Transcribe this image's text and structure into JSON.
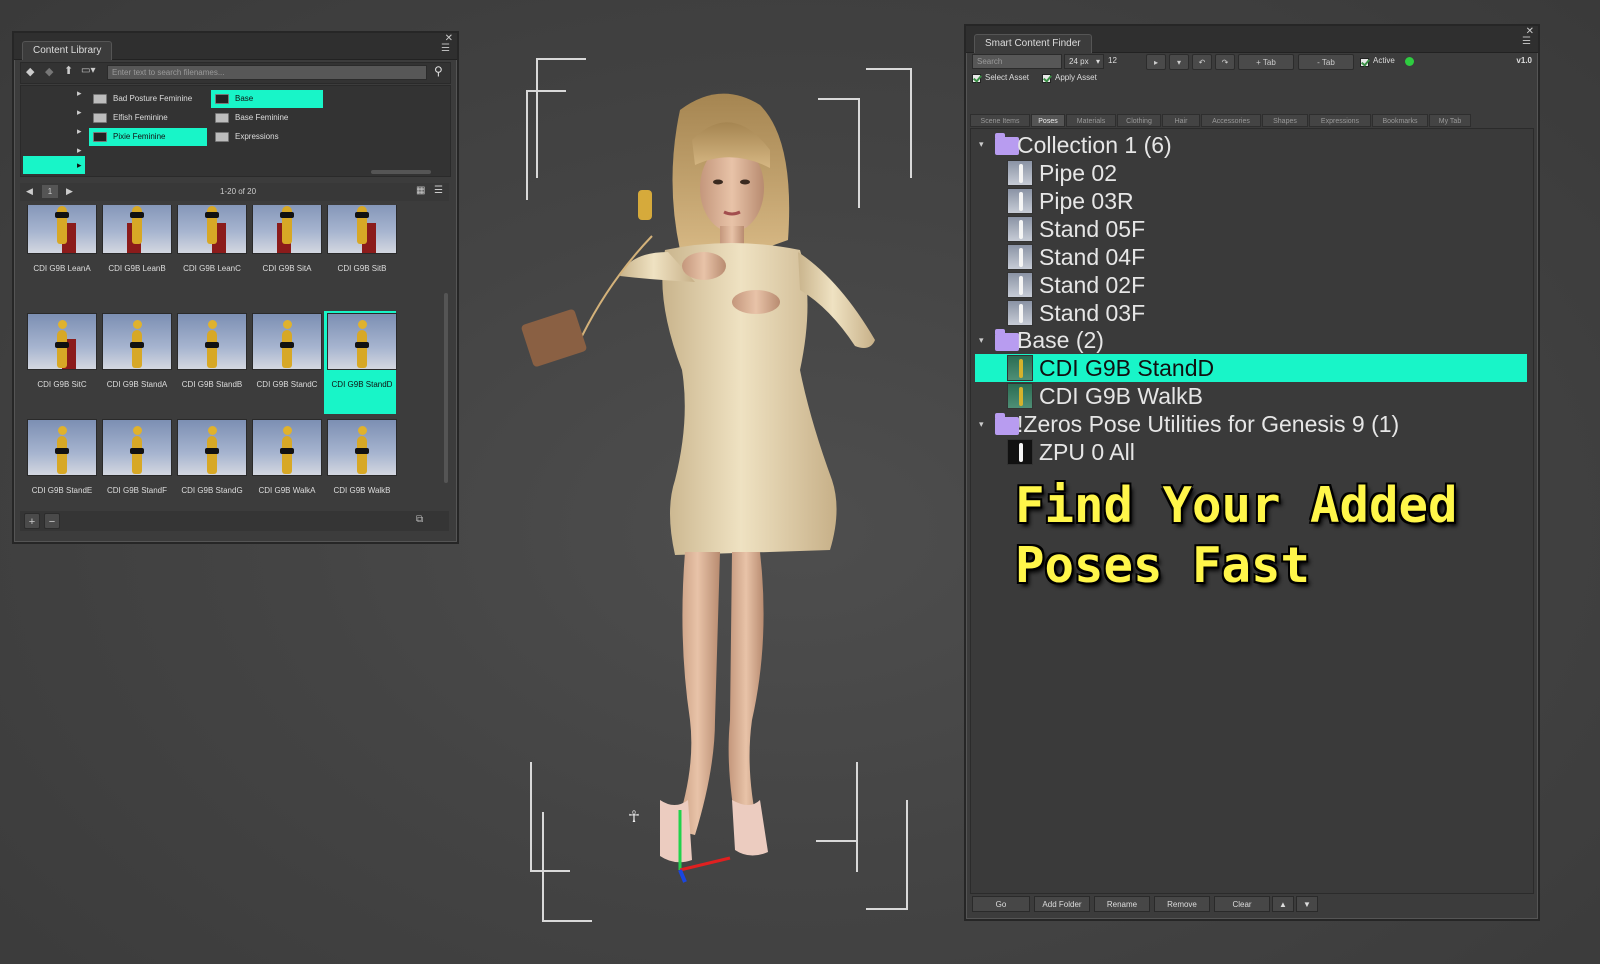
{
  "content_library": {
    "title": "Content Library",
    "search_placeholder": "Enter text to search filenames...",
    "folders": [
      {
        "label": "Bad Posture Feminine",
        "selected": false
      },
      {
        "label": "Base",
        "selected": true
      },
      {
        "label": "Elfish Feminine",
        "selected": false
      },
      {
        "label": "Base Feminine",
        "selected": false
      },
      {
        "label": "Pixie Feminine",
        "selected": true
      },
      {
        "label": "Expressions",
        "selected": false
      }
    ],
    "pager": {
      "page": "1",
      "range": "1-20 of 20"
    },
    "thumbnails": [
      "CDI G9B LeanA",
      "CDI G9B LeanB",
      "CDI G9B LeanC",
      "CDI G9B SitA",
      "CDI G9B SitB",
      "CDI G9B SitC",
      "CDI G9B StandA",
      "CDI G9B StandB",
      "CDI G9B StandC",
      "CDI G9B StandD",
      "CDI G9B StandE",
      "CDI G9B StandF",
      "CDI G9B StandG",
      "CDI G9B WalkA",
      "CDI G9B WalkB"
    ],
    "selected_thumbnail": "CDI G9B StandD",
    "footer": {
      "add": "+",
      "remove": "−"
    }
  },
  "smart_finder": {
    "title": "Smart Content Finder",
    "search_placeholder": "Search",
    "px_value": "24 px",
    "count_value": "12",
    "add_tab": "+ Tab",
    "remove_tab": "- Tab",
    "active_label": "Active",
    "version": "v1.0",
    "select_asset": "Select Asset",
    "apply_asset": "Apply Asset",
    "tabs": [
      "Scene Items",
      "Poses",
      "Materials",
      "Clothing",
      "Hair",
      "Accessories",
      "Shapes",
      "Expressions",
      "Bookmarks",
      "My Tab"
    ],
    "active_tab": "Poses",
    "tree": {
      "collection": {
        "label": "Collection 1 (6)",
        "items": [
          "Pipe 02",
          "Pipe 03R",
          "Stand 05F",
          "Stand 04F",
          "Stand 02F",
          "Stand 03F"
        ]
      },
      "base": {
        "label": "Base (2)",
        "items": [
          "CDI G9B StandD",
          "CDI G9B WalkB"
        ]
      },
      "zeros": {
        "label": "!Zeros Pose Utilities for Genesis 9 (1)",
        "items": [
          "ZPU 0 All"
        ]
      }
    },
    "selected_item": "CDI G9B StandD",
    "buttons": [
      "Go",
      "Add Folder",
      "Rename",
      "Remove",
      "Clear"
    ],
    "arrows": {
      "up": "▲",
      "down": "▼"
    }
  },
  "promo": {
    "line1": "Find Your Added",
    "line2": "Poses Fast"
  },
  "colors": {
    "selection": "#18f5c8",
    "promo_text": "#fff64a",
    "folder": "#b89cf0",
    "active_dot": "#2ecc40"
  }
}
